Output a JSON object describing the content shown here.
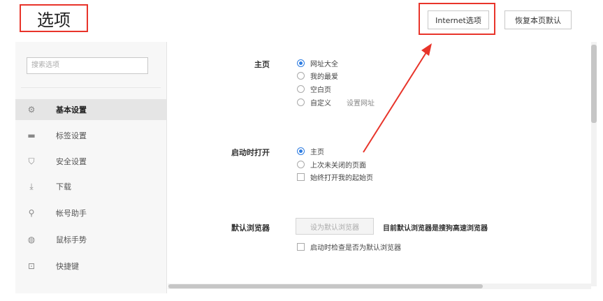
{
  "header": {
    "title": "选项",
    "internet_options_label": "Internet选项",
    "restore_default_label": "恢复本页默认"
  },
  "sidebar": {
    "search_placeholder": "搜索选项",
    "items": [
      {
        "label": "基本设置",
        "icon": "gear-icon",
        "active": true
      },
      {
        "label": "标签设置",
        "icon": "tab-icon",
        "active": false
      },
      {
        "label": "安全设置",
        "icon": "shield-icon",
        "active": false
      },
      {
        "label": "下载",
        "icon": "download-icon",
        "active": false
      },
      {
        "label": "帐号助手",
        "icon": "key-icon",
        "active": false
      },
      {
        "label": "鼠标手势",
        "icon": "mouse-icon",
        "active": false
      },
      {
        "label": "快捷键",
        "icon": "keyboard-icon",
        "active": false
      }
    ]
  },
  "homepage": {
    "label": "主页",
    "options": [
      "网址大全",
      "我的最爱",
      "空白页",
      "自定义"
    ],
    "selected": "网址大全",
    "set_url_link": "设置网址"
  },
  "startup": {
    "label": "启动时打开",
    "options": [
      "主页",
      "上次未关闭的页面"
    ],
    "selected": "主页",
    "checkbox_label": "始终打开我的起始页"
  },
  "default_browser": {
    "label": "默认浏览器",
    "button_label": "设为默认浏览器",
    "status_text": "目前默认浏览器是搜狗高速浏览器",
    "checkbox_label": "启动时检查是否为默认浏览器"
  },
  "colors": {
    "highlight_red": "#e8342a",
    "accent_blue": "#2f7de1"
  }
}
